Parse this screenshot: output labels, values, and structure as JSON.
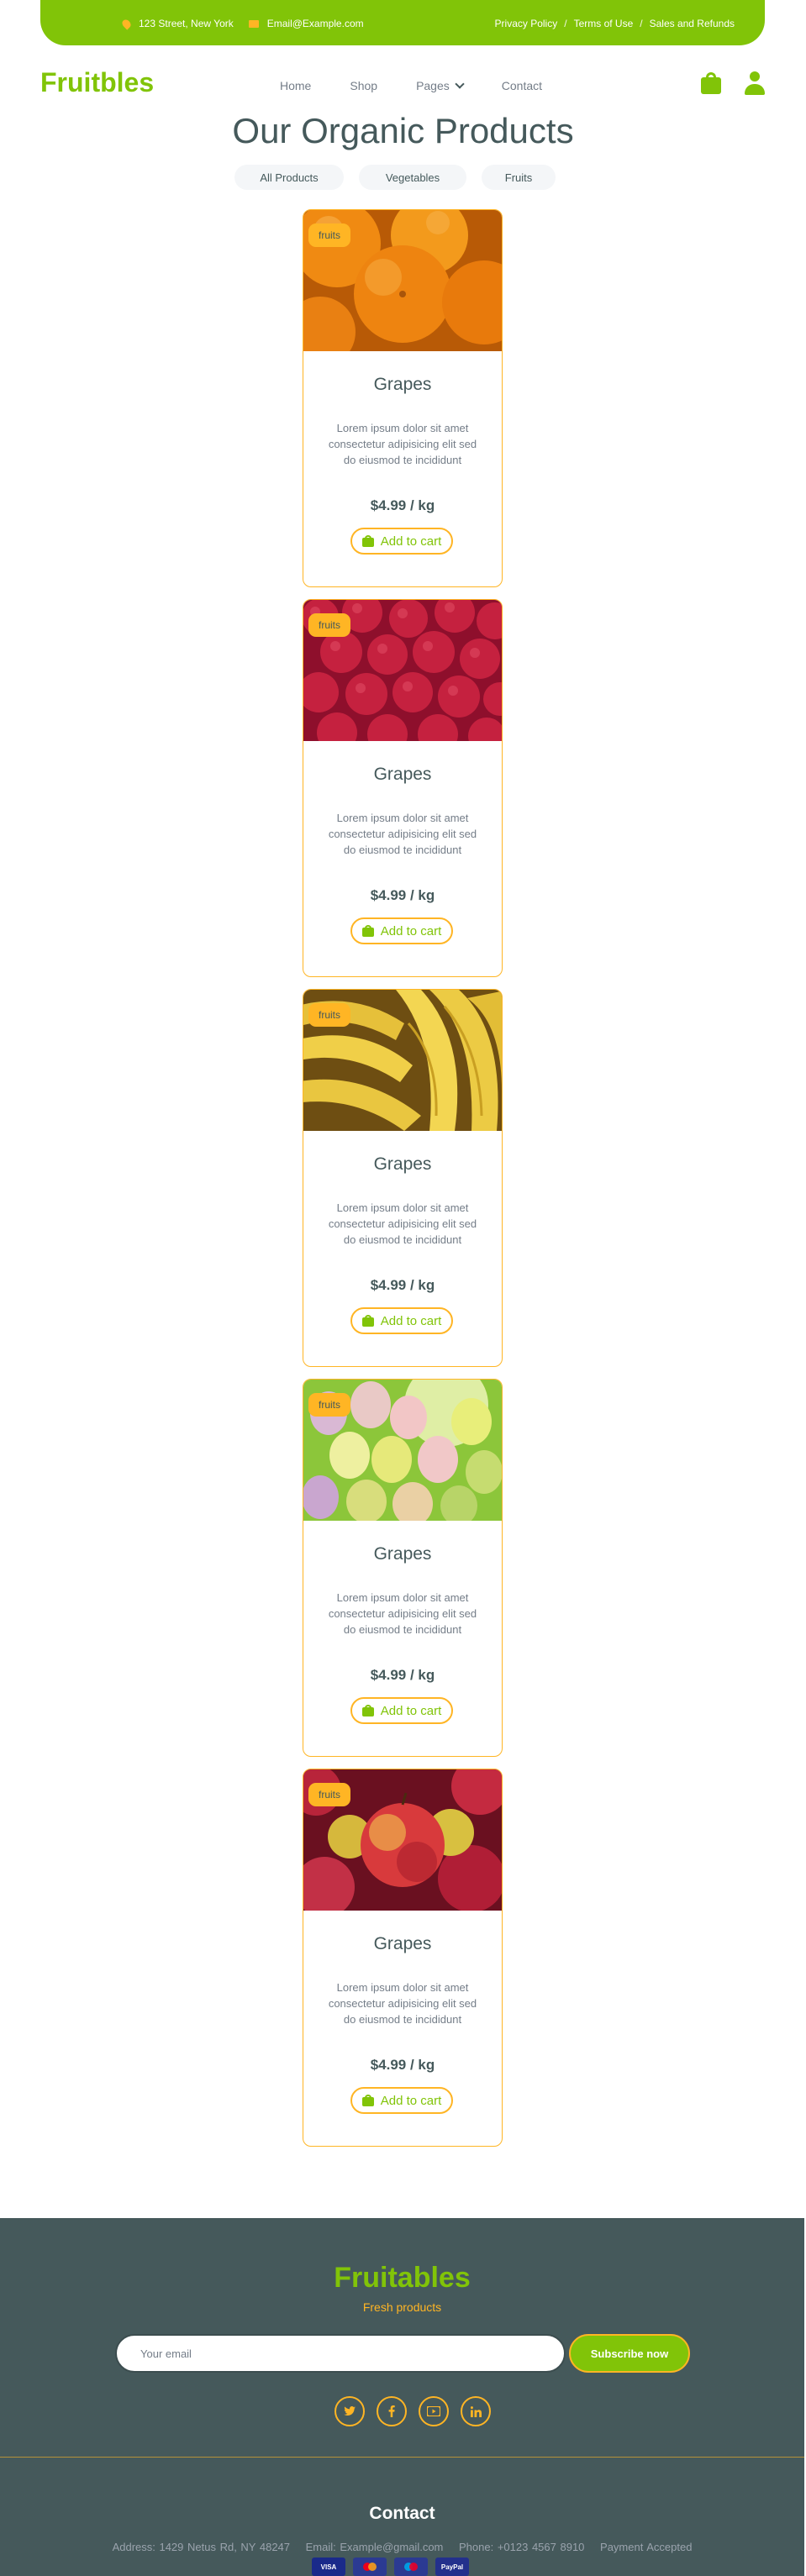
{
  "topbar": {
    "address": "123 Street, New York",
    "email": "Email@Example.com",
    "links": [
      "Privacy Policy",
      "Terms of Use",
      "Sales and Refunds"
    ],
    "separator": "/"
  },
  "navbar": {
    "brand": "Fruitbles",
    "menu": [
      "Home",
      "Shop",
      "Pages",
      "Contact"
    ]
  },
  "section": {
    "title": "Our Organic Products",
    "tabs": [
      "All Products",
      "Vegetables",
      "Fruits"
    ]
  },
  "products": [
    {
      "image": "oranges",
      "category": "fruits",
      "name": "Grapes",
      "description": "Lorem ipsum dolor sit amet consectetur adipisicing elit sed do eiusmod te incididunt",
      "price": "$4.99 / kg",
      "button": "Add to cart"
    },
    {
      "image": "raspberries",
      "category": "fruits",
      "name": "Grapes",
      "description": "Lorem ipsum dolor sit amet consectetur adipisicing elit sed do eiusmod te incididunt",
      "price": "$4.99 / kg",
      "button": "Add to cart"
    },
    {
      "image": "bananas",
      "category": "fruits",
      "name": "Grapes",
      "description": "Lorem ipsum dolor sit amet consectetur adipisicing elit sed do eiusmod te incididunt",
      "price": "$4.99 / kg",
      "button": "Add to cart"
    },
    {
      "image": "grapes",
      "category": "fruits",
      "name": "Grapes",
      "description": "Lorem ipsum dolor sit amet consectetur adipisicing elit sed do eiusmod te incididunt",
      "price": "$4.99 / kg",
      "button": "Add to cart"
    },
    {
      "image": "apples",
      "category": "fruits",
      "name": "Grapes",
      "description": "Lorem ipsum dolor sit amet consectetur adipisicing elit sed do eiusmod te incididunt",
      "price": "$4.99 / kg",
      "button": "Add to cart"
    }
  ],
  "footer": {
    "brand": "Fruitables",
    "tagline": "Fresh products",
    "email_placeholder": "Your email",
    "subscribe_label": "Subscribe now",
    "socials": [
      "twitter-icon",
      "facebook-icon",
      "youtube-icon",
      "linkedin-icon"
    ],
    "contact_title": "Contact",
    "address": "Address: 1429 Netus Rd, NY 48247",
    "email": "Email: Example@gmail.com",
    "phone": "Phone: +0123 4567 8910",
    "payment": "Payment Accepted",
    "payment_methods": [
      "VISA",
      "",
      "",
      "PayPal"
    ]
  },
  "colors": {
    "primary": "#81c408",
    "secondary": "#ffb524",
    "dark": "#45595b"
  }
}
